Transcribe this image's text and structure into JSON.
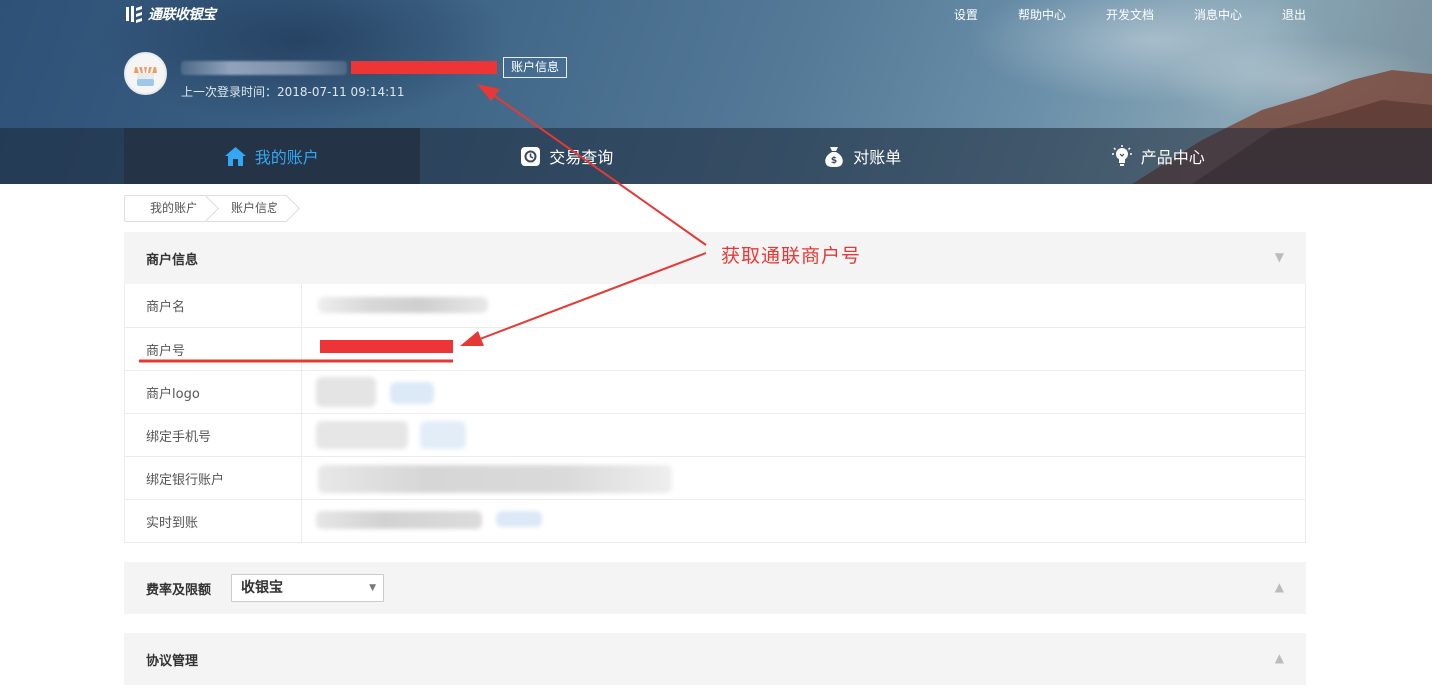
{
  "header": {
    "logo_text": "通联收银宝",
    "top_links": [
      "设置",
      "帮助中心",
      "开发文档",
      "消息中心",
      "退出"
    ],
    "account_info_button": "账户信息",
    "last_login": "上一次登录时间：2018-07-11 09:14:11"
  },
  "main_nav": {
    "tabs": [
      {
        "label": "我的账户",
        "icon": "home-icon",
        "active": true
      },
      {
        "label": "交易查询",
        "icon": "transaction-query-icon",
        "active": false
      },
      {
        "label": "对账单",
        "icon": "money-bag-icon",
        "active": false
      },
      {
        "label": "产品中心",
        "icon": "lightbulb-icon",
        "active": false
      }
    ],
    "active_color": "#33a7f3"
  },
  "breadcrumb": [
    "我的账户",
    "账户信息"
  ],
  "merchant_panel": {
    "title": "商户信息",
    "toggle": "▼",
    "rows": [
      {
        "label": "商户名"
      },
      {
        "label": "商户号"
      },
      {
        "label": "商户logo"
      },
      {
        "label": "绑定手机号"
      },
      {
        "label": "绑定银行账户"
      },
      {
        "label": "实时到账"
      }
    ]
  },
  "rate_panel": {
    "title": "费率及限额",
    "select_value": "收银宝",
    "toggle": "▲"
  },
  "agreement_panel": {
    "title": "协议管理",
    "toggle": "▲"
  },
  "annotation": {
    "text": "获取通联商户号",
    "color": "#e53935"
  },
  "redaction_color": "#ee3535"
}
